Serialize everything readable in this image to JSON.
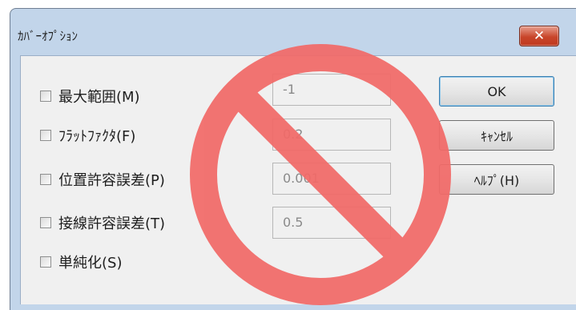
{
  "dialog": {
    "title": "ｶﾊﾞｰｵﾌﾟｼｮﾝ",
    "close_label": "✕"
  },
  "options": [
    {
      "label": "最大範囲(M)",
      "checked": false,
      "value": "-1"
    },
    {
      "label": "ﾌﾗｯﾄﾌｧｸﾀ(F)",
      "checked": false,
      "value": "0.2"
    },
    {
      "label": "位置許容誤差(P)",
      "checked": false,
      "value": "0.001"
    },
    {
      "label": "接線許容誤差(T)",
      "checked": false,
      "value": "0.5"
    },
    {
      "label": "単純化(S)",
      "checked": false
    }
  ],
  "buttons": {
    "ok": "OK",
    "cancel": "ｷｬﾝｾﾙ",
    "help": "ﾍﾙﾌﾟ(H)"
  },
  "overlay": {
    "icon": "prohibition-icon",
    "color": "#f26a68"
  },
  "colors": {
    "frame": "#c2d5ea",
    "client": "#f0f0f0",
    "close": "#c8452a"
  }
}
